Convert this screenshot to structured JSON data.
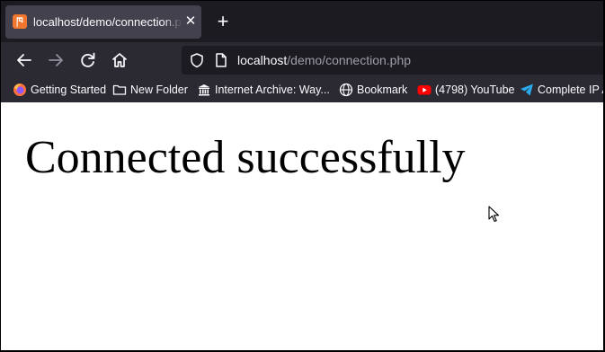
{
  "tab": {
    "title": "localhost/demo/connection.php",
    "favicon_icon": "xampp-icon",
    "close_icon": "close-icon",
    "new_tab_label": "+"
  },
  "nav": {
    "back_icon": "back-arrow-icon",
    "forward_icon": "forward-arrow-icon",
    "reload_icon": "reload-icon",
    "home_icon": "home-icon",
    "url_host": "localhost",
    "url_path": "/demo/connection.php"
  },
  "bookmarks": [
    {
      "label": "Getting Started",
      "icon": "firefox-icon"
    },
    {
      "label": "New Folder",
      "icon": "folder-icon"
    },
    {
      "label": "Internet Archive: Way...",
      "icon": "archive-icon"
    },
    {
      "label": "Bookmark",
      "icon": "globe-icon"
    },
    {
      "label": "(4798) YouTube",
      "icon": "youtube-icon"
    },
    {
      "label": "Complete IP A",
      "icon": "telegram-icon"
    }
  ],
  "page": {
    "heading": "Connected successfully"
  },
  "colors": {
    "tabstrip_bg": "#1c1b22",
    "toolbar_bg": "#2b2a33",
    "active_tab_bg": "#42414d",
    "text_light": "#fbfbfe",
    "url_path_gray": "#9e9ea6",
    "xampp_orange": "#f2772e",
    "youtube_red": "#ff0000",
    "telegram_blue": "#2aabee"
  }
}
